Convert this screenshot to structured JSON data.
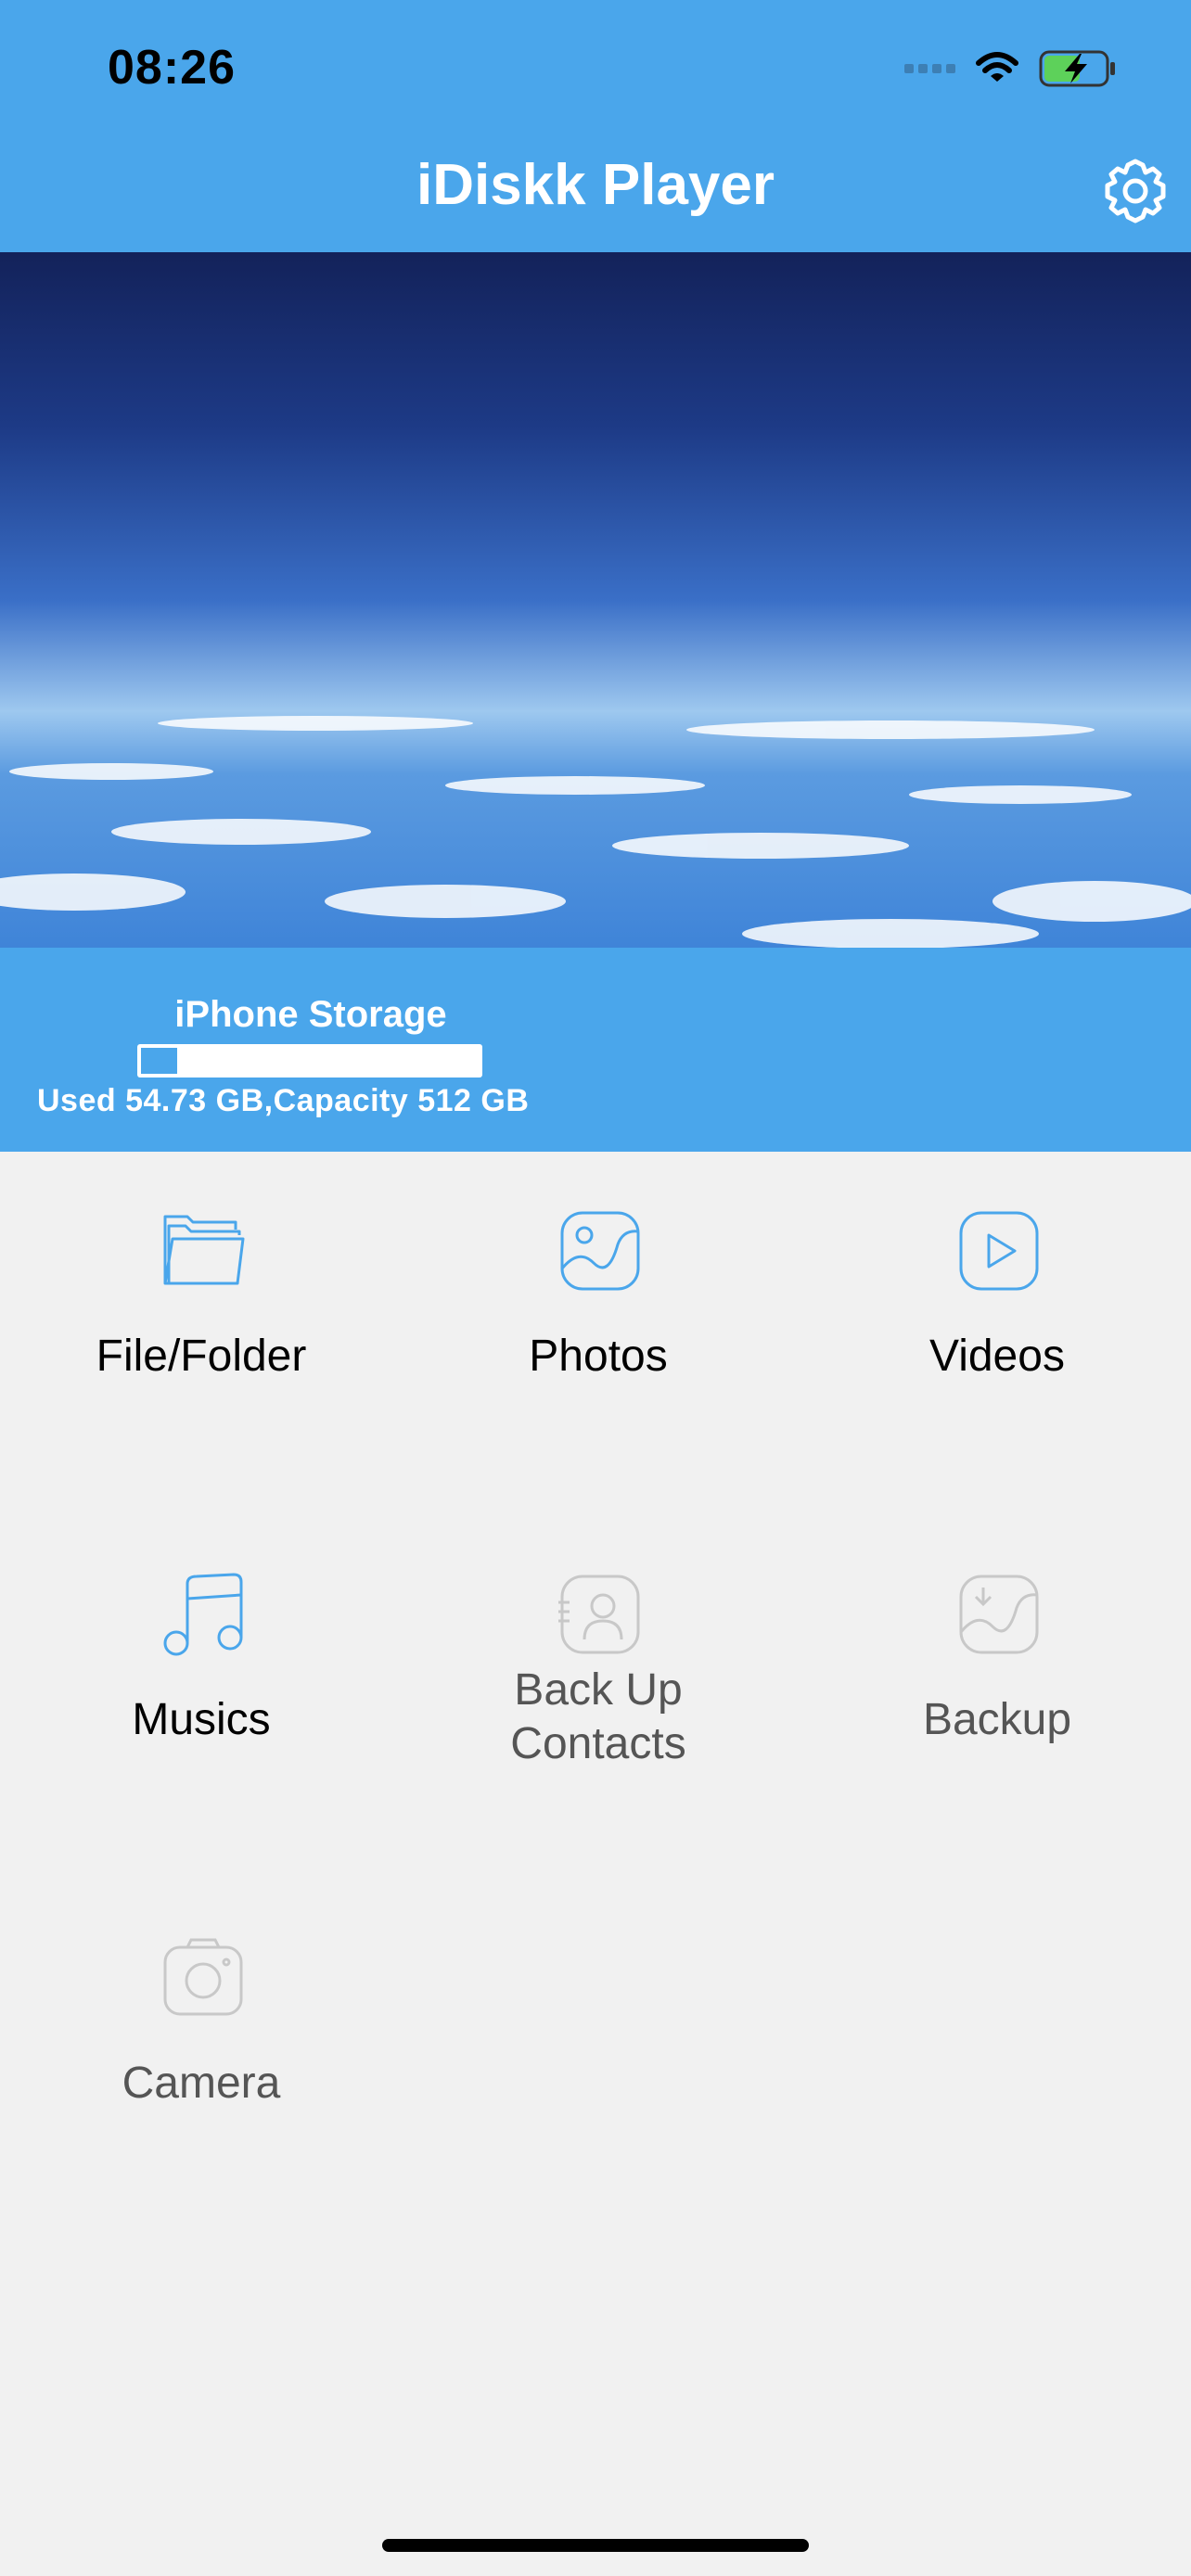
{
  "status_bar": {
    "time": "08:26"
  },
  "header": {
    "title": "iDiskk Player"
  },
  "storage": {
    "title": "iPhone Storage",
    "info": "Used 54.73 GB,Capacity 512 GB",
    "used_fraction": 0.107
  },
  "tiles": [
    {
      "label": "File/Folder",
      "icon": "folder-icon",
      "enabled": true
    },
    {
      "label": "Photos",
      "icon": "photo-icon",
      "enabled": true
    },
    {
      "label": "Videos",
      "icon": "play-icon",
      "enabled": true
    },
    {
      "label": "Musics",
      "icon": "music-note-icon",
      "enabled": true
    },
    {
      "label": "Back Up\nContacts",
      "icon": "contact-card-icon",
      "enabled": false
    },
    {
      "label": "Backup",
      "icon": "backup-photo-icon",
      "enabled": false
    },
    {
      "label": "Camera",
      "icon": "camera-icon",
      "enabled": false
    }
  ],
  "colors": {
    "accent": "#4aa6eb",
    "icon_active": "#4aa6eb",
    "icon_disabled": "#c8c8c8"
  }
}
